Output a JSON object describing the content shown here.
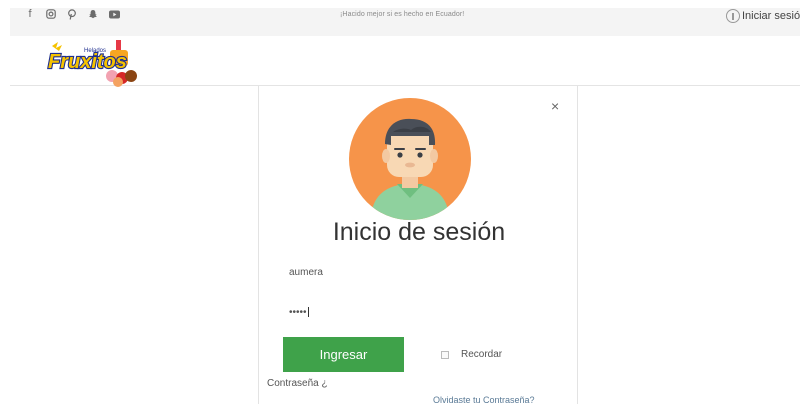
{
  "topbar": {
    "social_icons": [
      "facebook-icon",
      "instagram-icon",
      "pinterest-icon",
      "snapchat-icon",
      "youtube-icon"
    ],
    "tagline": "¡Hacido mejor si es hecho en Ecuador!",
    "login_link": "Iniciar sesió"
  },
  "header": {
    "logo_text": "Fruxitos",
    "logo_small": "Helados"
  },
  "modal": {
    "close": "×",
    "title": "Inicio de sesión",
    "username_value": "aumera",
    "password_value": "•••••",
    "submit_label": "Ingresar",
    "remember_label": "Recordar",
    "password_label": "Contraseña ¿",
    "forgot_link": "Olvidaste tu Contraseña?"
  },
  "colors": {
    "accent_green": "#3fa24a",
    "avatar_bg": "#f6944a"
  }
}
